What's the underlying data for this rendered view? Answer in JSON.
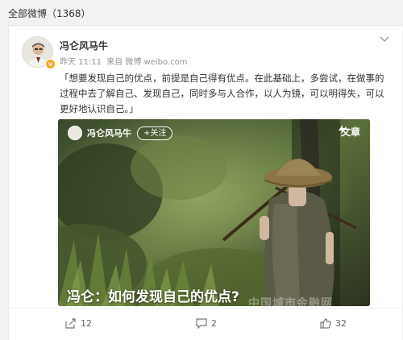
{
  "topbar": {
    "title": "全部微博（1368）"
  },
  "post": {
    "author": "冯仑风马牛",
    "verified_badge": "v",
    "time": "昨天 11:11",
    "source": "来自 微博 weibo.com",
    "menu_icon": "chevron-down-icon",
    "text": "「想要发现自己的优点，前提是自己得有优点。在此基础上，多尝试，在做事的过程中去了解自己、发现自己，同时多与人合作，以人为镜，可以明得失，可以更好地认识自己。」"
  },
  "media": {
    "author": "冯仑风马牛",
    "follow_label": "+关注",
    "tag_icon": "lightning-icon",
    "tag_label": "文章",
    "title": "冯仑：如何发现自己的优点?",
    "watermark": "中国城市金融网"
  },
  "actions": {
    "share": {
      "icon": "share-icon",
      "count": "12"
    },
    "comment": {
      "icon": "comment-icon",
      "count": "2"
    },
    "like": {
      "icon": "thumb-up-icon",
      "count": "32"
    }
  },
  "colors": {
    "page_bg": "#f2f2f2",
    "card_bg": "#ffffff",
    "badge": "#f6a623",
    "meta_text": "#939393"
  }
}
